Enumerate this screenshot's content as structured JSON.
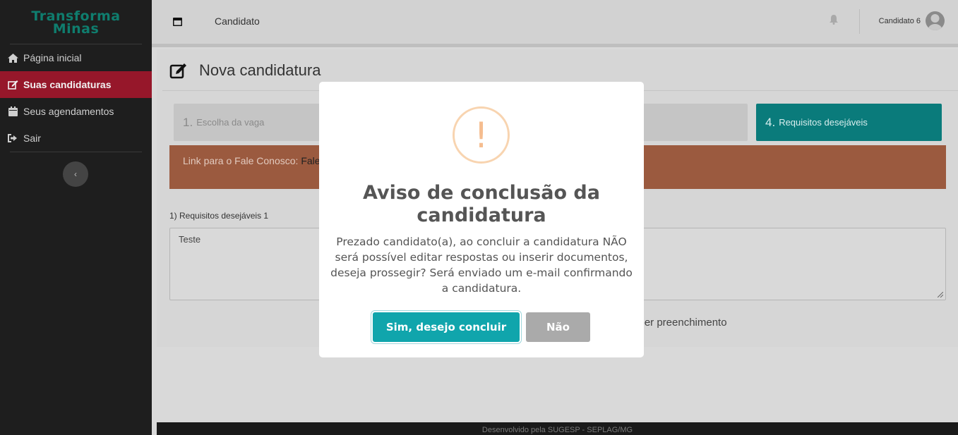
{
  "logo": {
    "line1": "Transforma",
    "line2": "Minas"
  },
  "sidebar": {
    "items": [
      {
        "label": "Página inicial",
        "icon": "home-icon"
      },
      {
        "label": "Suas candidaturas",
        "icon": "edit-icon",
        "active": true
      },
      {
        "label": "Seus agendamentos",
        "icon": "calendar-icon"
      },
      {
        "label": "Sair",
        "icon": "sign-out-icon"
      }
    ],
    "collapse_glyph": "‹"
  },
  "topbar": {
    "title": "Candidato",
    "user": "Candidato 6"
  },
  "page": {
    "title": "Nova candidatura"
  },
  "steps": [
    {
      "num": "1.",
      "label": "Escolha da vaga"
    },
    {
      "num": "4.",
      "label": "Requisitos desejáveis"
    }
  ],
  "alert": {
    "text": "Link para o Fale Conosco: ",
    "link": "Fale"
  },
  "question": {
    "label": "1) Requisitos desejáveis 1",
    "value": "Teste"
  },
  "save_text": "mper preenchimento",
  "footer": "Desenvolvido pela SUGESP - SEPLAG/MG",
  "modal": {
    "icon_glyph": "!",
    "title": "Aviso de conclusão da candidatura",
    "text": "Prezado candidato(a), ao concluir a candidatura NÃO será possível editar respostas ou inserir documentos, deseja prossegir? Será enviado um e-mail confirmando a candidatura.",
    "confirm_label": "Sim, desejo concluir",
    "cancel_label": "Não"
  },
  "colors": {
    "sidebar_bg": "#1e1e1e",
    "active_item": "#96172a",
    "brand": "#0f7d6e",
    "step_active": "#0a7b7b",
    "alert": "#9b5a3f",
    "confirm_button": "#10a5ac",
    "cancel_button": "#aaaaaa",
    "warning": "#f5bd8f"
  }
}
